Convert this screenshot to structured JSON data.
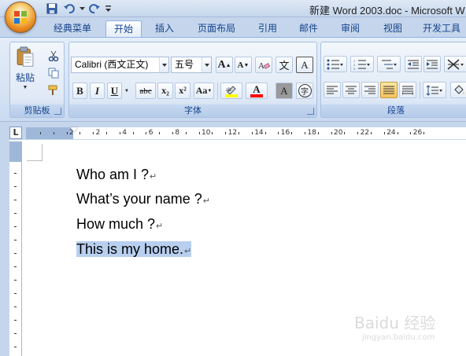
{
  "window": {
    "title": "新建 Word 2003.doc - Microsoft W"
  },
  "tabs": [
    "经典菜单",
    "开始",
    "插入",
    "页面布局",
    "引用",
    "邮件",
    "审阅",
    "视图",
    "开发工具"
  ],
  "active_tab": "开始",
  "ribbon": {
    "clipboard": {
      "label": "剪贴板",
      "paste_label": "粘贴"
    },
    "font": {
      "label": "字体",
      "font_name": "Calibri (西文正文)",
      "font_size": "五号",
      "bold": "B",
      "italic": "I",
      "underline": "U",
      "strike": "abc",
      "subscript": "x₂",
      "superscript": "x²",
      "change_case": "Aa",
      "grow": "A",
      "shrink": "A",
      "clear": "A",
      "pinyin": "文",
      "border_char": "A",
      "shade_char": "A",
      "enclose": "字",
      "highlight_color": "#ffff00",
      "font_color": "#ff0000"
    },
    "paragraph": {
      "label": "段落"
    }
  },
  "ruler": {
    "numbers": [
      "2",
      "2",
      "4",
      "6",
      "8",
      "10",
      "12",
      "14",
      "16",
      "18",
      "20",
      "22",
      "24",
      "26"
    ]
  },
  "document": {
    "lines": [
      "Who am I ?",
      "What’s your name ?",
      "How much ?",
      "This is my home."
    ],
    "selected_line_index": 3,
    "paragraph_mark": "↵"
  },
  "watermark": {
    "main": "Baidu 经验",
    "sub": "jingyan.baidu.com"
  }
}
